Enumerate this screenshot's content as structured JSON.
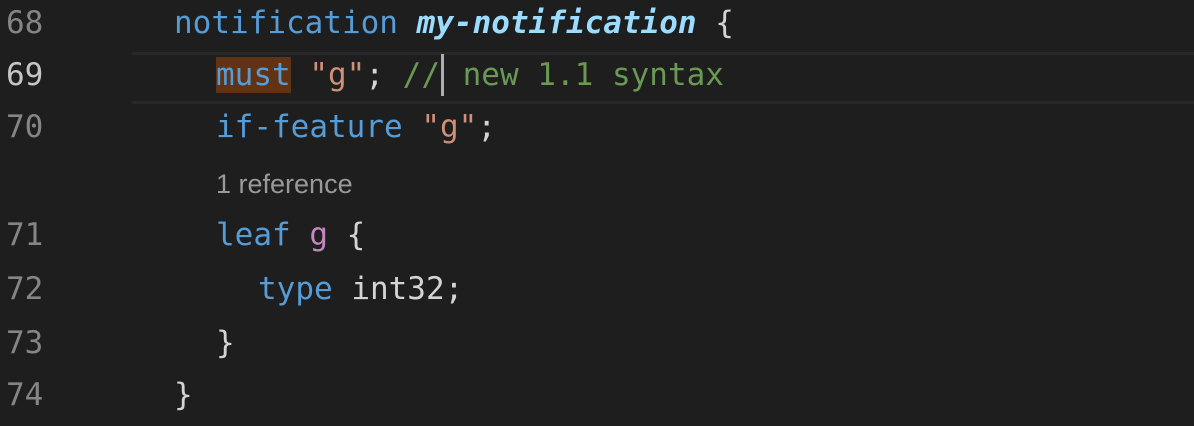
{
  "editor": {
    "lines": [
      {
        "number": "68",
        "tokens": [
          {
            "text": "notification",
            "kind": "keyword"
          },
          {
            "text": " ",
            "kind": "plain"
          },
          {
            "text": "my-notification",
            "kind": "name"
          },
          {
            "text": " {",
            "kind": "plain"
          }
        ]
      },
      {
        "number": "69",
        "current": true,
        "tokens": [
          {
            "text": "must",
            "kind": "keyword",
            "highlight": true
          },
          {
            "text": " ",
            "kind": "plain"
          },
          {
            "text": "\"g\"",
            "kind": "string"
          },
          {
            "text": "; ",
            "kind": "plain"
          },
          {
            "text": "//",
            "kind": "comment"
          },
          {
            "text": " new 1.1 syntax",
            "kind": "comment"
          }
        ]
      },
      {
        "number": "70",
        "tokens": [
          {
            "text": "if-feature",
            "kind": "keyword"
          },
          {
            "text": " ",
            "kind": "plain"
          },
          {
            "text": "\"g\"",
            "kind": "string"
          },
          {
            "text": ";",
            "kind": "plain"
          }
        ]
      },
      {
        "number": "71",
        "tokens": [
          {
            "text": "leaf",
            "kind": "keyword"
          },
          {
            "text": " ",
            "kind": "plain"
          },
          {
            "text": "g",
            "kind": "ident"
          },
          {
            "text": " {",
            "kind": "plain"
          }
        ]
      },
      {
        "number": "72",
        "tokens": [
          {
            "text": "type",
            "kind": "keyword"
          },
          {
            "text": " int32;",
            "kind": "plain"
          }
        ]
      },
      {
        "number": "73",
        "tokens": [
          {
            "text": "}",
            "kind": "plain"
          }
        ]
      },
      {
        "number": "74",
        "tokens": [
          {
            "text": "}",
            "kind": "plain"
          }
        ]
      }
    ],
    "codelens": "1 reference",
    "colors": {
      "background": "#1e1e1e",
      "keyword": "#569cd6",
      "name": "#9cdcfe",
      "string": "#ce9178",
      "comment": "#6a9955",
      "ident": "#c586c0",
      "plain": "#d4d4d4",
      "highlight": "#613214"
    }
  }
}
